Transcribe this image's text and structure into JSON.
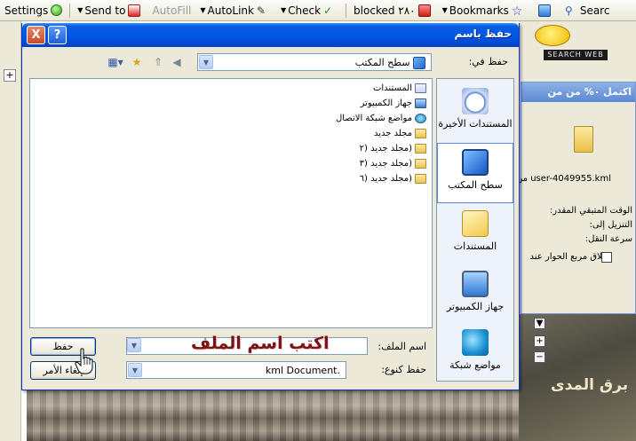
{
  "toolbar": {
    "settings": "Settings",
    "send_to": "Send to",
    "autofill": "AutoFill",
    "autolink": "AutoLink",
    "check": "Check",
    "blocked": "blocked ٢٨٠",
    "bookmarks": "Bookmarks",
    "search": "Searc"
  },
  "background": {
    "search_label": "SEARCH WEB",
    "panel_title": "اكتمل ٠% من  من",
    "download_file": "user-4049955.kml من",
    "time_remaining": "الوقت المتبقي المقدر:",
    "download_to": "التنزيل إلى:",
    "transfer_rate": "سرعة النقل:",
    "close_dialog": "إغلاق مربع الحوار عند",
    "map_label": "برق المدى",
    "zoom_in": "+",
    "zoom_out": "−",
    "left_plus": "+"
  },
  "dialog": {
    "title": "حفظ باسم",
    "help": "?",
    "close": "X",
    "save_in_label": "حفظ في:",
    "save_in_value": "سطح المكتب",
    "places": [
      {
        "label": "المستندات الأخيرة",
        "icon": "recent-documents-icon"
      },
      {
        "label": "سطح المكتب",
        "icon": "desktop-icon"
      },
      {
        "label": "المستندات",
        "icon": "documents-icon"
      },
      {
        "label": "جهاز الكمبيوتر",
        "icon": "my-computer-icon"
      },
      {
        "label": "مواضع شبكة",
        "icon": "network-places-icon"
      }
    ],
    "files": [
      {
        "name": "المستندات",
        "kind": "doc"
      },
      {
        "name": "جهاز الكمبيوتر",
        "kind": "pc"
      },
      {
        "name": "مواضع شبكة الاتصال",
        "kind": "net"
      },
      {
        "name": "مجلد جديد",
        "kind": "folder"
      },
      {
        "name": "(مجلد جديد (٢",
        "kind": "folder"
      },
      {
        "name": "(مجلد جديد (٣",
        "kind": "folder"
      },
      {
        "name": "(مجلد جديد (٦",
        "kind": "folder"
      }
    ],
    "filename_label": "اسم الملف:",
    "filename_value": "",
    "filename_overlay": "اكتب اسم الملف",
    "filetype_label": "حفظ كنوع:",
    "filetype_value": ".kml Document",
    "save_button": "حفظ",
    "cancel_button": "إلغاء الأمر"
  }
}
